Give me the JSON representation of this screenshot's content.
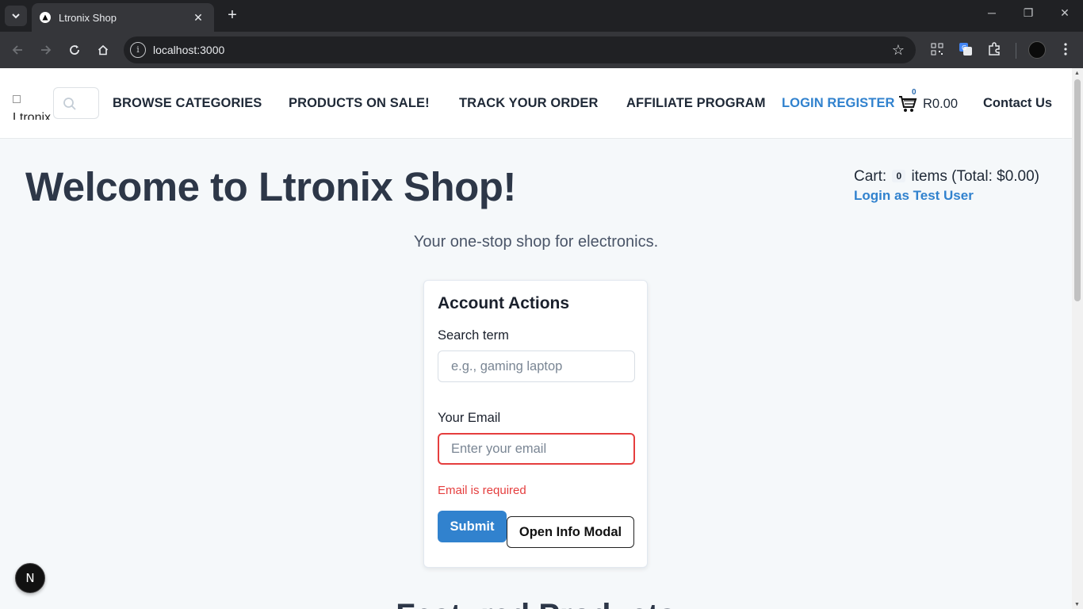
{
  "browser": {
    "tab_title": "Ltronix Shop",
    "url": "localhost:3000",
    "new_tab_label": "+",
    "tab_close_label": "✕"
  },
  "header": {
    "logo_alt": "Ltronix",
    "nav": {
      "browse": "BROWSE CATEGORIES",
      "sale": "PRODUCTS ON SALE!",
      "track": "TRACK YOUR ORDER",
      "affiliate": "AFFILIATE PROGRAM",
      "login": "LOGIN REGISTER",
      "contact": "Contact Us"
    },
    "cart_badge": "0",
    "cart_amount": "R0.00"
  },
  "main": {
    "welcome_title": "Welcome to Ltronix Shop!",
    "tagline": "Your one-stop shop for electronics.",
    "cart_summary": {
      "prefix": "Cart:",
      "count": "0",
      "suffix": "items (Total: $0.00)"
    },
    "test_user_link": "Login as Test User",
    "featured_heading": "Featured Products"
  },
  "account_card": {
    "title": "Account Actions",
    "search_label": "Search term",
    "search_placeholder": "e.g., gaming laptop",
    "email_label": "Your Email",
    "email_placeholder": "Enter your email",
    "email_error": "Email is required",
    "submit_label": "Submit",
    "modal_label": "Open Info Modal"
  },
  "dev_badge": "N",
  "colors": {
    "accent": "#3182ce",
    "error": "#e53e3e",
    "heading": "#2d3748",
    "page_bg": "#f5f8fa"
  }
}
